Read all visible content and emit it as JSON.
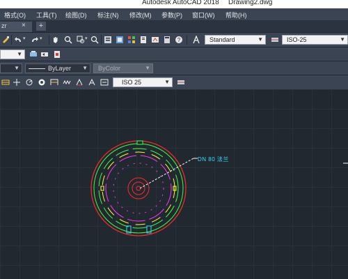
{
  "window": {
    "app_title": "Autodesk AutoCAD 2018",
    "file_name": "Drawing2.dwg"
  },
  "menubar": {
    "items": [
      {
        "label": "格式(O)"
      },
      {
        "label": "工具(T)"
      },
      {
        "label": "绘图(D)"
      },
      {
        "label": "标注(N)"
      },
      {
        "label": "修改(M)"
      },
      {
        "label": "参数(P)"
      },
      {
        "label": "窗口(W)"
      },
      {
        "label": "帮助(H)"
      }
    ]
  },
  "tabs": {
    "active_label": "zr",
    "close_glyph": "×",
    "new_tab_glyph": "+"
  },
  "styles_toolbar": {
    "text_style": "Standard",
    "dim_style": "ISO-25"
  },
  "properties_toolbar": {
    "linetype": "ByLayer",
    "lineweight": "ByColor"
  },
  "dimension_toolbar": {
    "dim_style": "ISO 25"
  },
  "drawing": {
    "annotation_text": "DN 80 法兰",
    "colors": {
      "background": "#212830",
      "green": "#3cff3c",
      "red": "#ff2a2a",
      "magenta": "#ff33ff",
      "yellow": "#ffff33",
      "cyan": "#33e0ff",
      "white": "#ffffff"
    }
  }
}
